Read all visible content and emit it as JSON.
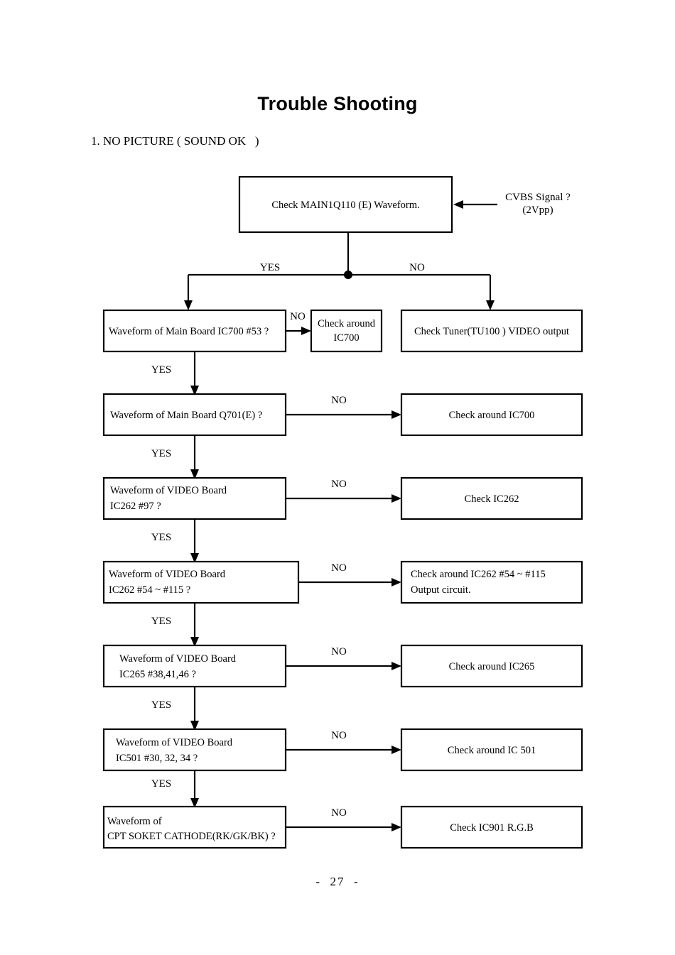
{
  "document": {
    "title": "Trouble Shooting",
    "section_heading": "1. NO PICTURE ( SOUND OK   )",
    "footer": "-  27  -"
  },
  "side_note": {
    "line1": "CVBS Signal ?",
    "line2": "(2Vpp)"
  },
  "edge_labels": {
    "yes": "YES",
    "no": "NO"
  },
  "boxes": {
    "start": {
      "line1": "Check MAIN1Q110 (E) Waveform."
    },
    "d1": {
      "line1": "Waveform of Main Board IC700 #53 ?"
    },
    "d1_no": {
      "line1": "Check around",
      "line2": "IC700"
    },
    "start_no": {
      "line1": "Check Tuner(TU100 ) VIDEO output"
    },
    "d2": {
      "line1": "Waveform of  Main  Board Q701(E) ?"
    },
    "d2_no": {
      "line1": "Check around  IC700"
    },
    "d3": {
      "line1": "Waveform  of  VIDEO Board",
      "line2": "IC262  #97 ?"
    },
    "d3_no": {
      "line1": "Check  IC262"
    },
    "d4": {
      "line1": "Waveform  of VIDEO Board",
      "line2": "IC262  #54 ~ #115 ?"
    },
    "d4_no": {
      "line1": "Check around  IC262  #54 ~ #115",
      "line2": "Output circuit."
    },
    "d5": {
      "line1": "Waveform of VIDEO Board",
      "line2": "IC265  #38,41,46 ?"
    },
    "d5_no": {
      "line1": "Check  around  IC265"
    },
    "d6": {
      "line1": "Waveform of VIDEO Board",
      "line2": "IC501  #30, 32, 34 ?"
    },
    "d6_no": {
      "line1": "Check around  IC 501"
    },
    "d7": {
      "line1": "Waveform of",
      "line2": "CPT SOKET CATHODE(RK/GK/BK) ?"
    },
    "d7_no": {
      "line1": "Check IC901 R.G.B"
    }
  }
}
